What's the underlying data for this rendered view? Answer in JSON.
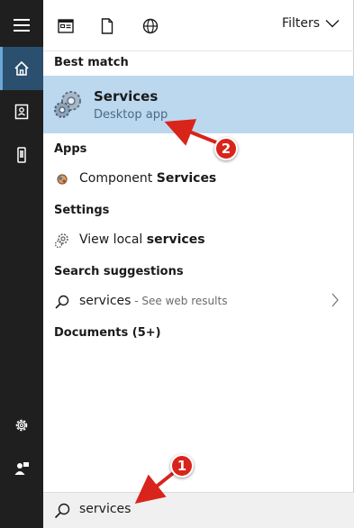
{
  "colors": {
    "rail": "#1f1f1f",
    "rail_active": "#2b4f6e",
    "highlight": "#bcd8ee",
    "annotation": "#d9241b"
  },
  "rail": {
    "items": [
      {
        "icon": "hamburger-menu-icon"
      },
      {
        "icon": "home-icon"
      },
      {
        "icon": "notebook-icon"
      },
      {
        "icon": "device-icon"
      },
      {
        "icon": "gear-icon"
      },
      {
        "icon": "feedback-person-icon"
      }
    ]
  },
  "topbar": {
    "icons": [
      "apps-icon",
      "document-icon",
      "web-globe-icon"
    ],
    "filters_label": "Filters"
  },
  "sections": {
    "best_match": "Best match",
    "apps": "Apps",
    "settings": "Settings",
    "search_suggestions": "Search suggestions",
    "documents": "Documents (5+)"
  },
  "best_match": {
    "title": "Services",
    "subtitle": "Desktop app"
  },
  "apps": {
    "prefix": "Component ",
    "bold": "Services"
  },
  "settings": {
    "prefix": "View local ",
    "bold": "services"
  },
  "suggestion": {
    "term": "services",
    "hint": " - See web results"
  },
  "search": {
    "query": "services"
  },
  "annotations": {
    "one": "1",
    "two": "2"
  }
}
